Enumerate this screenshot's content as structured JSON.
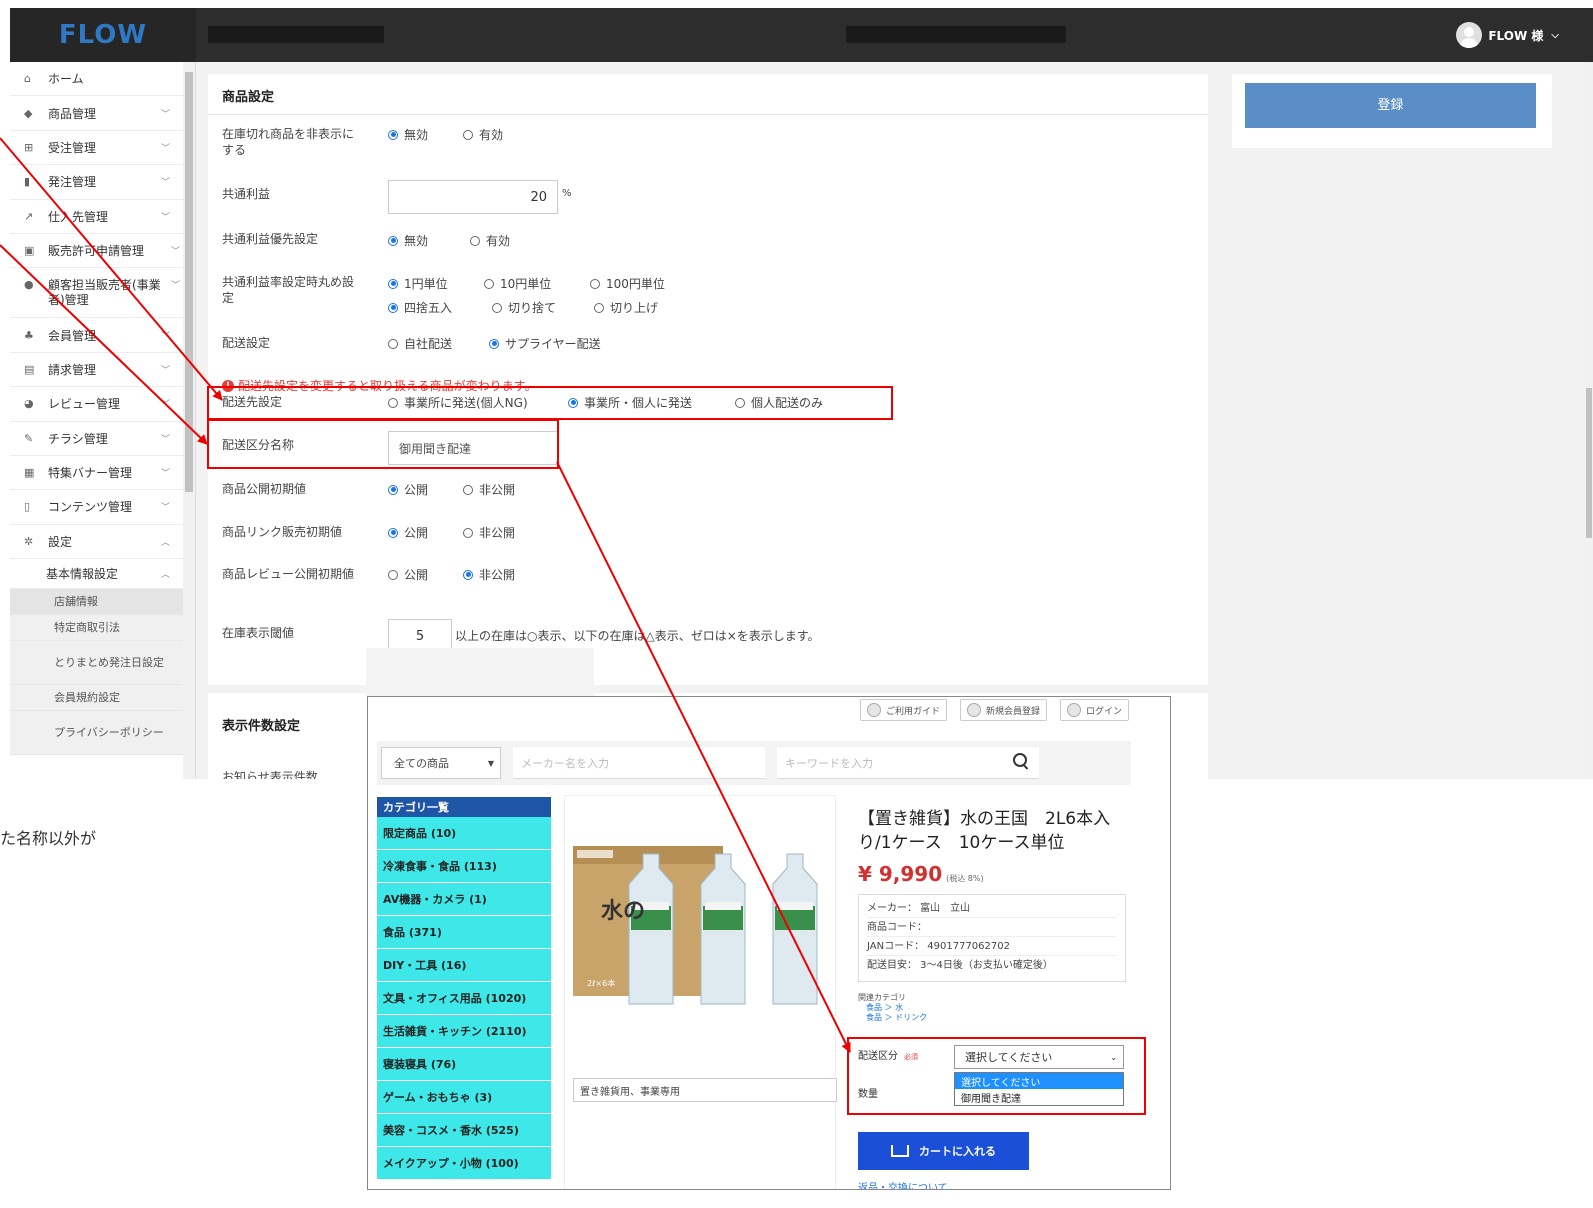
{
  "app": {
    "logo": "FLOW",
    "user_name": "FLOW 様"
  },
  "sidebar": {
    "items": [
      {
        "label": "ホーム",
        "icon": "home-icon"
      },
      {
        "label": "商品管理",
        "icon": "tag-icon"
      },
      {
        "label": "受注管理",
        "icon": "cart-icon"
      },
      {
        "label": "発注管理",
        "icon": "book-icon"
      },
      {
        "label": "仕入先管理",
        "icon": "share-icon"
      },
      {
        "label": "販売許可申請管理",
        "icon": "briefcase-icon"
      },
      {
        "label": "顧客担当販売者(事業者)管理",
        "icon": "person-icon"
      },
      {
        "label": "会員管理",
        "icon": "group-icon"
      },
      {
        "label": "請求管理",
        "icon": "document-icon"
      },
      {
        "label": "レビュー管理",
        "icon": "comment-icon"
      },
      {
        "label": "チラシ管理",
        "icon": "pen-icon"
      },
      {
        "label": "特集バナー管理",
        "icon": "file-icon"
      },
      {
        "label": "コンテンツ管理",
        "icon": "file-outline-icon"
      },
      {
        "label": "設定",
        "icon": "gear-icon"
      }
    ],
    "sub_label": "基本情報設定",
    "sub_items": [
      "店舗情報",
      "特定商取引法",
      "とりまとめ発注日設定",
      "会員規約設定",
      "プライバシーポリシー"
    ]
  },
  "panel": {
    "title": "商品設定",
    "rows": {
      "out_of_stock": {
        "label": "在庫切れ商品を非表示にする",
        "options": [
          "無効",
          "有効"
        ]
      },
      "profit": {
        "label": "共通利益",
        "value": "20",
        "unit": "%"
      },
      "profit_priority": {
        "label": "共通利益優先設定",
        "options": [
          "無効",
          "有効"
        ]
      },
      "rounding": {
        "label": "共通利益率設定時丸め設定",
        "options1": [
          "1円単位",
          "10円単位",
          "100円単位"
        ],
        "options2": [
          "四捨五入",
          "切り捨て",
          "切り上げ"
        ]
      },
      "delivery": {
        "label": "配送設定",
        "options": [
          "自社配送",
          "サプライヤー配送"
        ]
      },
      "warning": "配送先設定を変更すると取り扱える商品が変わります。",
      "destination": {
        "label": "配送先設定",
        "options": [
          "事業所に発送(個人NG)",
          "事業所・個人に発送",
          "個人配送のみ"
        ]
      },
      "division_name": {
        "label": "配送区分名称",
        "value": "御用聞き配達"
      },
      "publish_default": {
        "label": "商品公開初期値",
        "options": [
          "公開",
          "非公開"
        ]
      },
      "link_default": {
        "label": "商品リンク販売初期値",
        "options": [
          "公開",
          "非公開"
        ]
      },
      "review_default": {
        "label": "商品レビュー公開初期値",
        "options": [
          "公開",
          "非公開"
        ]
      },
      "stock_threshold": {
        "label": "在庫表示閾値",
        "value": "5",
        "note": "以上の在庫は○表示、以下の在庫は△表示、ゼロは×を表示します。"
      }
    }
  },
  "panel2": {
    "title": "表示件数設定",
    "row_label": "お知らせ表示件数"
  },
  "register_button": "登録",
  "side_note": "た名称以外が",
  "shop": {
    "top_links": [
      "ご利用ガイド",
      "新規会員登録",
      "ログイン"
    ],
    "search": {
      "category": "全ての商品",
      "maker_placeholder": "メーカー名を入力",
      "keyword_placeholder": "キーワードを入力"
    },
    "categories_title": "カテゴリ一覧",
    "categories": [
      "限定商品 (10)",
      "冷凍食事・食品 (113)",
      "AV機器・カメラ (1)",
      "食品 (371)",
      "DIY・工具 (16)",
      "文具・オフィス用品 (1020)",
      "生活雑貨・キッチン (2110)",
      "寝装寝具 (76)",
      "ゲーム・おもちゃ (3)",
      "美容・コスメ・香水 (525)",
      "メイクアップ・小物 (100)"
    ],
    "product": {
      "title": "【置き雑貨】水の王国　2L6本入り/1ケース　10ケース単位",
      "price": "¥ 9,990",
      "tax_note": "(税込 8%)",
      "specs": [
        "メーカー： 富山　立山",
        "商品コード：",
        "JANコード： 4901777062702",
        "配送目安： 3〜4日後（お支払い確定後）"
      ],
      "related_label": "関連カテゴリ",
      "related": [
        "食品 ＞ 水",
        "食品 ＞ ドリンク"
      ],
      "image_caption": "置き雑貨用、事業専用",
      "division_label": "配送区分",
      "required": "必須",
      "qty_label": "数量",
      "select_value": "選択してください",
      "dropdown_options": [
        "選択してください",
        "御用聞き配達"
      ],
      "cart_button": "カートに入れる",
      "return_link": "返品・交換について"
    }
  }
}
